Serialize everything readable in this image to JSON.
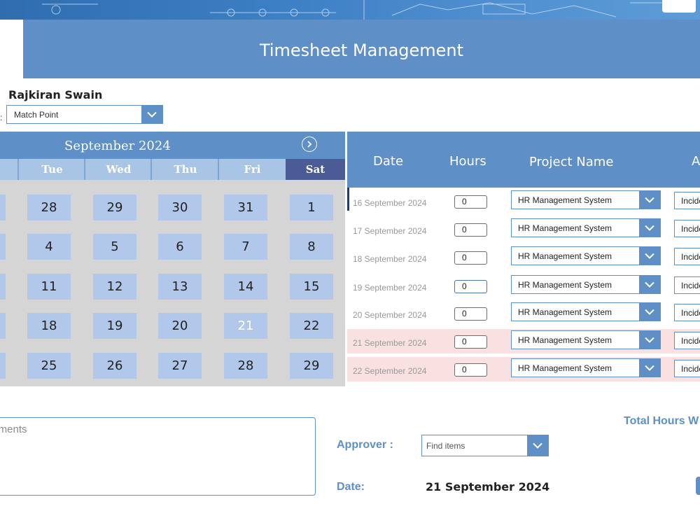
{
  "app": {
    "title": "Timesheet Management"
  },
  "user": {
    "name": "Rajkiran Swain",
    "label_colon": ":"
  },
  "project_selector": {
    "value": "Match Point"
  },
  "calendar": {
    "month_label": "September 2024",
    "weekdays": [
      "Tue",
      "Wed",
      "Thu",
      "Fri",
      "Sat"
    ],
    "weeks": [
      [
        "28",
        "29",
        "30",
        "31",
        "1"
      ],
      [
        "4",
        "5",
        "6",
        "7",
        "8"
      ],
      [
        "11",
        "12",
        "13",
        "14",
        "15"
      ],
      [
        "18",
        "19",
        "20",
        "21",
        "22"
      ],
      [
        "25",
        "26",
        "27",
        "28",
        "29"
      ]
    ],
    "selected_day": "21"
  },
  "table": {
    "headers": {
      "date": "Date",
      "hours": "Hours",
      "project": "Project Name",
      "activity": "A"
    },
    "rows": [
      {
        "date": "16 September 2024",
        "hours": "0",
        "project": "HR Management System",
        "activity": "Incident"
      },
      {
        "date": "17 September 2024",
        "hours": "0",
        "project": "HR Management System",
        "activity": "Incident"
      },
      {
        "date": "18 September 2024",
        "hours": "0",
        "project": "HR Management System",
        "activity": "Incident"
      },
      {
        "date": "19 September 2024",
        "hours": "0",
        "project": "HR Management System",
        "activity": "Incident"
      },
      {
        "date": "20 September 2024",
        "hours": "0",
        "project": "HR Management System",
        "activity": "Incident"
      },
      {
        "date": "21 September 2024",
        "hours": "0",
        "project": "HR Management System",
        "activity": "Incident"
      },
      {
        "date": "22 September 2024",
        "hours": "0",
        "project": "HR Management System",
        "activity": "Incident"
      }
    ]
  },
  "comments": {
    "placeholder": "Comments"
  },
  "approver": {
    "label": "Approver :",
    "placeholder": "Find items"
  },
  "summary": {
    "date_label": "Date:",
    "date_value": "21 September 2024",
    "total_hours_label": "Total Hours W"
  },
  "colors": {
    "accent": "#5e8fc6",
    "saturday": "#4a5b95",
    "weekend_row": "#f9e1e1",
    "day_cell": "#b2c8ea"
  }
}
